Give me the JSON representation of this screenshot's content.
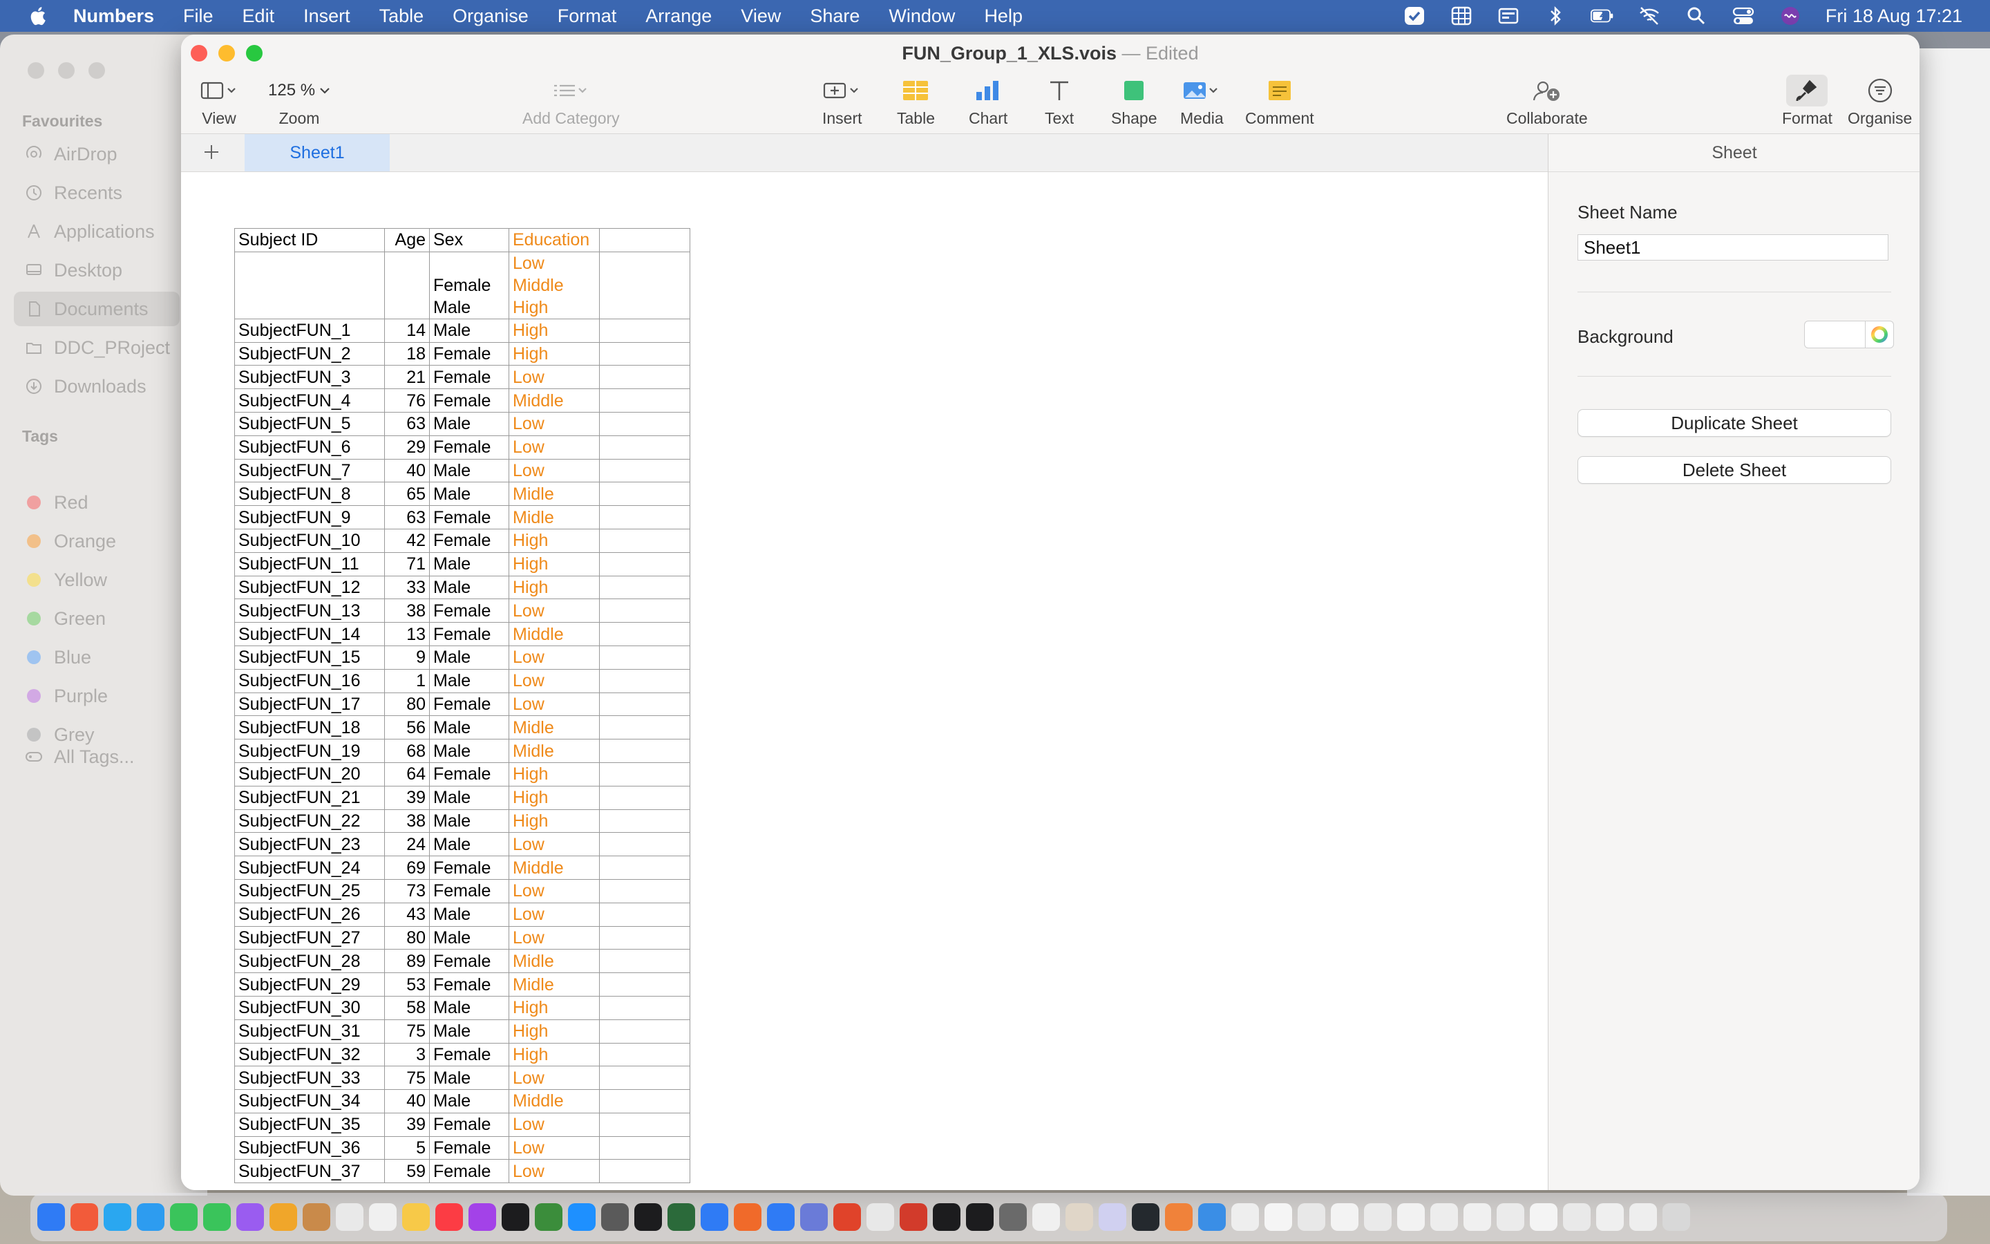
{
  "menubar": {
    "app": "Numbers",
    "items": [
      "File",
      "Edit",
      "Insert",
      "Table",
      "Organise",
      "Format",
      "Arrange",
      "View",
      "Share",
      "Window",
      "Help"
    ],
    "clock": "Fri 18 Aug  17:21"
  },
  "finder": {
    "favourites_title": "Favourites",
    "favourites": [
      "AirDrop",
      "Recents",
      "Applications",
      "Desktop",
      "Documents",
      "DDC_PRoject",
      "Downloads"
    ],
    "tags_title": "Tags",
    "tags": [
      {
        "label": "Red",
        "color": "#f0a0a0"
      },
      {
        "label": "Orange",
        "color": "#f2c089"
      },
      {
        "label": "Yellow",
        "color": "#f3e08d"
      },
      {
        "label": "Green",
        "color": "#a6d9a0"
      },
      {
        "label": "Blue",
        "color": "#9fc4f0"
      },
      {
        "label": "Purple",
        "color": "#d2a9e4"
      },
      {
        "label": "Grey",
        "color": "#c4c4c4"
      }
    ],
    "all_tags": "All Tags..."
  },
  "window": {
    "title": "FUN_Group_1_XLS.vois",
    "separator": "—",
    "status": "Edited"
  },
  "toolbar": {
    "view": "View",
    "zoom_value": "125 %",
    "zoom": "Zoom",
    "add_category": "Add Category",
    "insert": "Insert",
    "table": "Table",
    "chart": "Chart",
    "text": "Text",
    "shape": "Shape",
    "media": "Media",
    "comment": "Comment",
    "collaborate": "Collaborate",
    "format": "Format",
    "organise": "Organise"
  },
  "tabs": {
    "sheet1": "Sheet1"
  },
  "table": {
    "headers": [
      "Subject ID",
      "Age",
      "Sex",
      "Education",
      ""
    ],
    "popup_sex": [
      "",
      "Female",
      "Male"
    ],
    "popup_education": [
      "Low",
      "Middle",
      "High"
    ],
    "rows": [
      [
        "SubjectFUN_1",
        "14",
        "Male",
        "High"
      ],
      [
        "SubjectFUN_2",
        "18",
        "Female",
        "High"
      ],
      [
        "SubjectFUN_3",
        "21",
        "Female",
        "Low"
      ],
      [
        "SubjectFUN_4",
        "76",
        "Female",
        "Middle"
      ],
      [
        "SubjectFUN_5",
        "63",
        "Male",
        "Low"
      ],
      [
        "SubjectFUN_6",
        "29",
        "Female",
        "Low"
      ],
      [
        "SubjectFUN_7",
        "40",
        "Male",
        "Low"
      ],
      [
        "SubjectFUN_8",
        "65",
        "Male",
        "Midle"
      ],
      [
        "SubjectFUN_9",
        "63",
        "Female",
        "Midle"
      ],
      [
        "SubjectFUN_10",
        "42",
        "Female",
        "High"
      ],
      [
        "SubjectFUN_11",
        "71",
        "Male",
        "High"
      ],
      [
        "SubjectFUN_12",
        "33",
        "Male",
        "High"
      ],
      [
        "SubjectFUN_13",
        "38",
        "Female",
        "Low"
      ],
      [
        "SubjectFUN_14",
        "13",
        "Female",
        "Middle"
      ],
      [
        "SubjectFUN_15",
        "9",
        "Male",
        "Low"
      ],
      [
        "SubjectFUN_16",
        "1",
        "Male",
        "Low"
      ],
      [
        "SubjectFUN_17",
        "80",
        "Female",
        "Low"
      ],
      [
        "SubjectFUN_18",
        "56",
        "Male",
        "Midle"
      ],
      [
        "SubjectFUN_19",
        "68",
        "Male",
        "Midle"
      ],
      [
        "SubjectFUN_20",
        "64",
        "Female",
        "High"
      ],
      [
        "SubjectFUN_21",
        "39",
        "Male",
        "High"
      ],
      [
        "SubjectFUN_22",
        "38",
        "Male",
        "High"
      ],
      [
        "SubjectFUN_23",
        "24",
        "Male",
        "Low"
      ],
      [
        "SubjectFUN_24",
        "69",
        "Female",
        "Middle"
      ],
      [
        "SubjectFUN_25",
        "73",
        "Female",
        "Low"
      ],
      [
        "SubjectFUN_26",
        "43",
        "Male",
        "Low"
      ],
      [
        "SubjectFUN_27",
        "80",
        "Male",
        "Low"
      ],
      [
        "SubjectFUN_28",
        "89",
        "Female",
        "Midle"
      ],
      [
        "SubjectFUN_29",
        "53",
        "Female",
        "Midle"
      ],
      [
        "SubjectFUN_30",
        "58",
        "Male",
        "High"
      ],
      [
        "SubjectFUN_31",
        "75",
        "Male",
        "High"
      ],
      [
        "SubjectFUN_32",
        "3",
        "Female",
        "High"
      ],
      [
        "SubjectFUN_33",
        "75",
        "Male",
        "Low"
      ],
      [
        "SubjectFUN_34",
        "40",
        "Male",
        "Middle"
      ],
      [
        "SubjectFUN_35",
        "39",
        "Female",
        "Low"
      ],
      [
        "SubjectFUN_36",
        "5",
        "Female",
        "Low"
      ],
      [
        "SubjectFUN_37",
        "59",
        "Female",
        "Low"
      ]
    ]
  },
  "inspector": {
    "title": "Sheet",
    "sheet_name_label": "Sheet Name",
    "sheet_name_value": "Sheet1",
    "background_label": "Background",
    "duplicate": "Duplicate Sheet",
    "delete": "Delete Sheet"
  },
  "colors": {
    "menubar": "#3b67b1",
    "accent": "#1f6fe0",
    "education_text": "#ef8a1a",
    "close": "#fe5f57",
    "minimize": "#febc2e",
    "zoom": "#28c840"
  }
}
